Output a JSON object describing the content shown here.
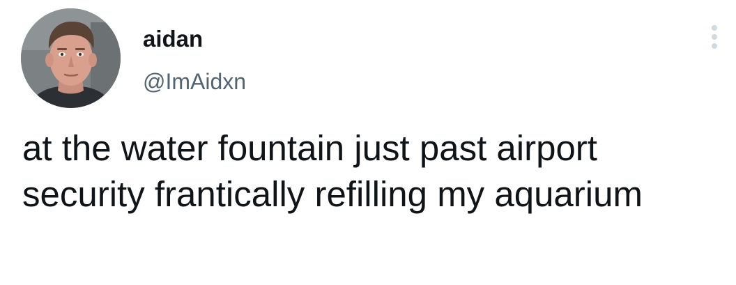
{
  "tweet": {
    "author": {
      "display_name": "aidan",
      "handle": "@ImAidxn"
    },
    "text": "at the water fountain just past airport security frantically refilling my aquarium",
    "more_icon": "more-vertical-icon"
  },
  "colors": {
    "text": "#0f1419",
    "secondary": "#536471",
    "icon": "#cfd9de",
    "background": "#ffffff"
  }
}
